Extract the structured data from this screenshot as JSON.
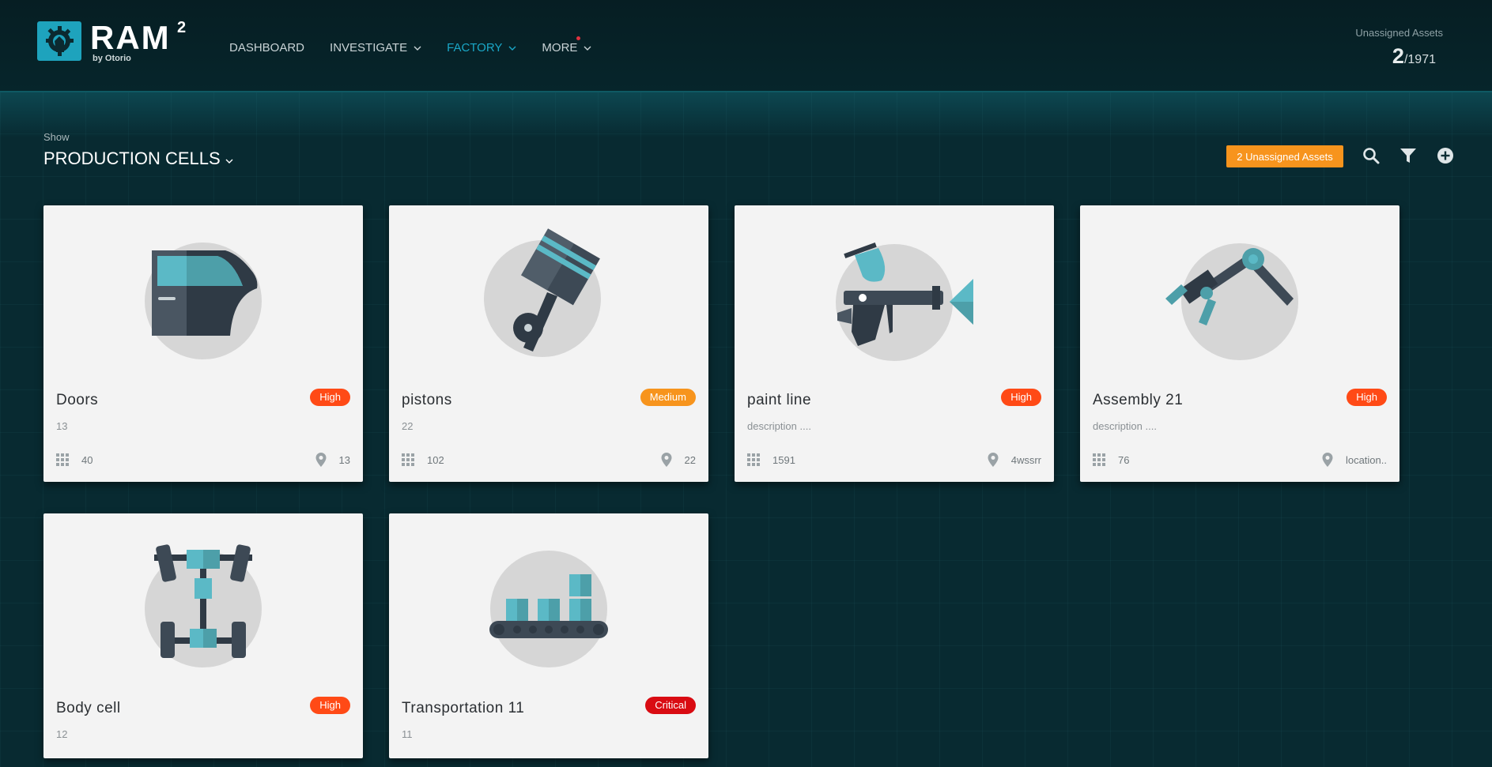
{
  "app": {
    "logo_text": "RAM",
    "logo_sup": "2",
    "logo_sub": "by Otorio"
  },
  "nav": {
    "dashboard": "DASHBOARD",
    "investigate": "INVESTIGATE",
    "factory": "FACTORY",
    "more": "MORE"
  },
  "header_stats": {
    "label": "Unassigned Assets",
    "count": "2",
    "total": "/1971"
  },
  "toolbar": {
    "show_label": "Show",
    "view_value": "PRODUCTION CELLS",
    "unassigned_button": "2 Unassigned Assets"
  },
  "colors": {
    "accent": "#1aa7c7",
    "high": "#ff4a16",
    "medium": "#f7941d",
    "critical": "#d90b12"
  },
  "cards": [
    {
      "title": "Doors",
      "severity": "High",
      "desc": "13",
      "assets": "40",
      "location": "13",
      "icon": "car-door-icon"
    },
    {
      "title": "pistons",
      "severity": "Medium",
      "desc": "22",
      "assets": "102",
      "location": "22",
      "icon": "piston-icon"
    },
    {
      "title": "paint line",
      "severity": "High",
      "desc": "description ....",
      "assets": "1591",
      "location": "4wssrr",
      "icon": "spray-gun-icon"
    },
    {
      "title": "Assembly 21",
      "severity": "High",
      "desc": "description ....",
      "assets": "76",
      "location": "location..",
      "icon": "robot-arm-icon"
    },
    {
      "title": "Body cell",
      "severity": "High",
      "desc": "12",
      "icon": "chassis-icon"
    },
    {
      "title": "Transportation 11",
      "severity": "Critical",
      "desc": "11",
      "icon": "conveyor-icon"
    }
  ]
}
